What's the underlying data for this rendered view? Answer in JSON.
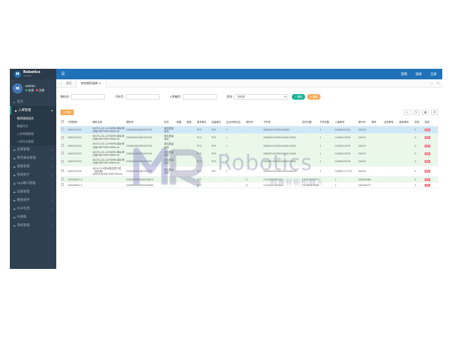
{
  "brand": {
    "logo_text": "Robotics",
    "logo_sub": "robotics"
  },
  "user": {
    "name": "admin",
    "online": "在线",
    "logout": "注销"
  },
  "sidebar": {
    "items": [
      {
        "label": "首页",
        "icon": "home-icon"
      },
      {
        "label": "入库管理",
        "icon": "folder-icon",
        "active": true
      },
      {
        "label": "出库管理",
        "icon": "folder-icon"
      },
      {
        "label": "库存报表管理",
        "icon": "folder-icon"
      },
      {
        "label": "基础管理",
        "icon": "folder-icon"
      },
      {
        "label": "系统执行",
        "icon": "folder-icon"
      },
      {
        "label": "app端口管理",
        "icon": "folder-icon"
      },
      {
        "label": "设备管理",
        "icon": "folder-icon"
      },
      {
        "label": "看板组件",
        "icon": "folder-icon"
      },
      {
        "label": "AGV任务",
        "icon": "folder-icon"
      },
      {
        "label": "升级版",
        "icon": "folder-icon"
      },
      {
        "label": "系统管理",
        "icon": "folder-icon"
      }
    ],
    "sub_items": [
      "物资接收组合",
      "数据作业",
      "入库单据管理",
      "入库作业管理"
    ]
  },
  "topbar": {
    "menu": "☰",
    "right": [
      "官网",
      "锁屏",
      "全屏"
    ]
  },
  "tabs": {
    "home": "首页",
    "current": "库房物资清单",
    "current_close": "×"
  },
  "search": {
    "fields": [
      {
        "label": "物料名:",
        "placeholder": ""
      },
      {
        "label": "子料号:",
        "placeholder": ""
      },
      {
        "label": "入库编号:",
        "placeholder": ""
      }
    ],
    "status_label": "状态:",
    "status_value": "已补货",
    "search_btn": "搜索",
    "reset_btn": "重置"
  },
  "toolbar": {
    "export": "导出"
  },
  "table": {
    "headers": [
      "",
      "子料物号",
      "物料名称",
      "物料号",
      "形式",
      "规格",
      "颜色",
      "基本单位",
      "包装单位",
      "企业代码日后",
      "母件号",
      "子件号",
      "总件已数",
      "子件件数",
      "入库单号",
      "单行号",
      "单号",
      "业务单号",
      "收用单号",
      "状态",
      "操作"
    ],
    "rows": [
      {
        "c": [
          "",
          "S4E100790",
          "WGTG-ZG-CLT96PRU调水率分组488*558*1665mm",
          "S0000000S4E100790",
          "单位数量组合",
          "-",
          "-",
          "PCS",
          "PCS",
          "1",
          "-",
          "S0S4E100790I0040X1",
          "-",
          "1",
          "01861C0102",
          "00019",
          "-",
          "-",
          "-",
          "0",
          "删除"
        ],
        "style": "r-sel"
      },
      {
        "c": [
          "",
          "S4E100790",
          "WGTG-ZG-CLT96PRU调水率分组488*558*1665mm",
          "S0000000S4E100790",
          "单位数量组合",
          "-",
          "-",
          "PCS",
          "PCS",
          "1",
          "-",
          "S0S4E100790I0040X13001",
          "-",
          "1",
          "01861C0576",
          "00019",
          "-",
          "-",
          "-",
          "0",
          "删除"
        ],
        "style": "r-g"
      },
      {
        "c": [
          "",
          "S4E100790",
          "WGTG-ZG-CLT96PRU调水率分组488*558*1665mm",
          "S0000000S4E100790",
          "单位数量组合",
          "-",
          "-",
          "PCS",
          "PCS",
          "1",
          "-",
          "S0S4E100790I0040X13001",
          "-",
          "1",
          "01861C0576",
          "00019",
          "-",
          "-",
          "-",
          "0",
          "删除"
        ],
        "style": "r-g"
      },
      {
        "c": [
          "",
          "S4E100790",
          "WGTG-ZG-CLT96PRU调水率分组488*558*1665mm",
          "S0000000S4E100790",
          "单位数量组合",
          "-",
          "-",
          "PCS",
          "PCS",
          "1",
          "-",
          "S0S4E100790I0040X13004",
          "-",
          "1",
          "01861C0576",
          "00019",
          "-",
          "-",
          "-",
          "0",
          "删除"
        ],
        "style": "r-g"
      },
      {
        "c": [
          "",
          "S4E100790",
          "WGTG-ZG-CLT96PRU调水率分组488*558*1665mm",
          "S0000000S4E100790",
          "单位数量组合",
          "-",
          "-",
          "PCS",
          "PCS",
          "1",
          "-",
          "S0S4E100790I0040X13005",
          "-",
          "1",
          "01861C0576",
          "00019",
          "-",
          "-",
          "-",
          "0",
          "删除"
        ],
        "style": "r-g"
      },
      {
        "c": [
          "",
          "S4E100790",
          "WGV-FS-8型水箱定型方成（加底钢）(SPRD)@358*358*36mm",
          "S0000000S4E100790",
          "单位数量组合",
          "-",
          "-",
          "SET",
          "SET",
          "1",
          "-",
          "S0S4E100790I00S12169001",
          "-",
          "1",
          "01861C17770",
          "00019",
          "-",
          "-",
          "-",
          "0",
          "删除"
        ],
        "style": "r-w"
      },
      {
        "c": [
          "",
          "S0016023-4",
          "-",
          "S000000000S0016023",
          "-",
          "-",
          "-",
          "SET",
          "-",
          "-",
          "0",
          "1012S00787221",
          "1012S00787210404",
          "-",
          "1",
          "S0R26286200",
          "-",
          "-",
          "-",
          "0",
          "删除"
        ],
        "style": "r-g"
      },
      {
        "c": [
          "",
          "S0S26000-2",
          "-",
          "S000000000S0S26000",
          "-",
          "-",
          "-",
          "SET",
          "-",
          "-",
          "0",
          "1013401335S43",
          "1013401335S43S402",
          "-",
          "1",
          "S0S26479S099",
          "-",
          "-",
          "-",
          "0",
          "删除"
        ],
        "style": "r-w"
      }
    ]
  },
  "watermark": {
    "text": "Robotics",
    "cn": "明睿智能机器人"
  }
}
